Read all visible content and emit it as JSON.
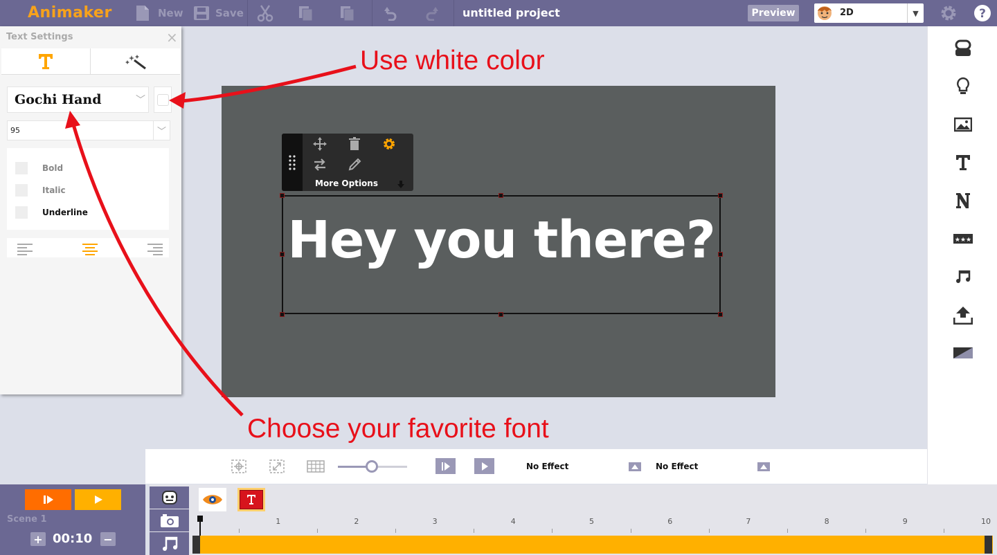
{
  "app": {
    "logo": "Animaker",
    "toolbar": {
      "new_label": "New",
      "save_label": "Save",
      "project_title": "untitled project",
      "preview_label": "Preview",
      "mode_value": "2D"
    }
  },
  "text_settings": {
    "title": "Text Settings",
    "close": "×",
    "font_family_value": "Gochi Hand",
    "font_size_value": "95",
    "styles": [
      {
        "label": "Bold",
        "active": false
      },
      {
        "label": "Italic",
        "active": false
      },
      {
        "label": "Underline",
        "active": true
      }
    ],
    "alignment_selected": "center"
  },
  "canvas": {
    "text": "Hey you there?",
    "more_options_label": "More Options"
  },
  "annotations": {
    "color_hint": "Use white color",
    "font_hint": "Choose your favorite font"
  },
  "controls": {
    "enter_effect": "No Effect",
    "exit_effect": "No Effect"
  },
  "timeline": {
    "scene_label": "Scene  1",
    "duration": "00:10",
    "ticks": [
      "1",
      "2",
      "3",
      "4",
      "5",
      "6",
      "7",
      "8",
      "9",
      "10"
    ]
  },
  "colors": {
    "header": "#6b6893",
    "accent_orange": "#ff6d00",
    "accent_yellow": "#ffb000",
    "annotation_red": "#e8101a",
    "stage": "#5a5e5e"
  }
}
